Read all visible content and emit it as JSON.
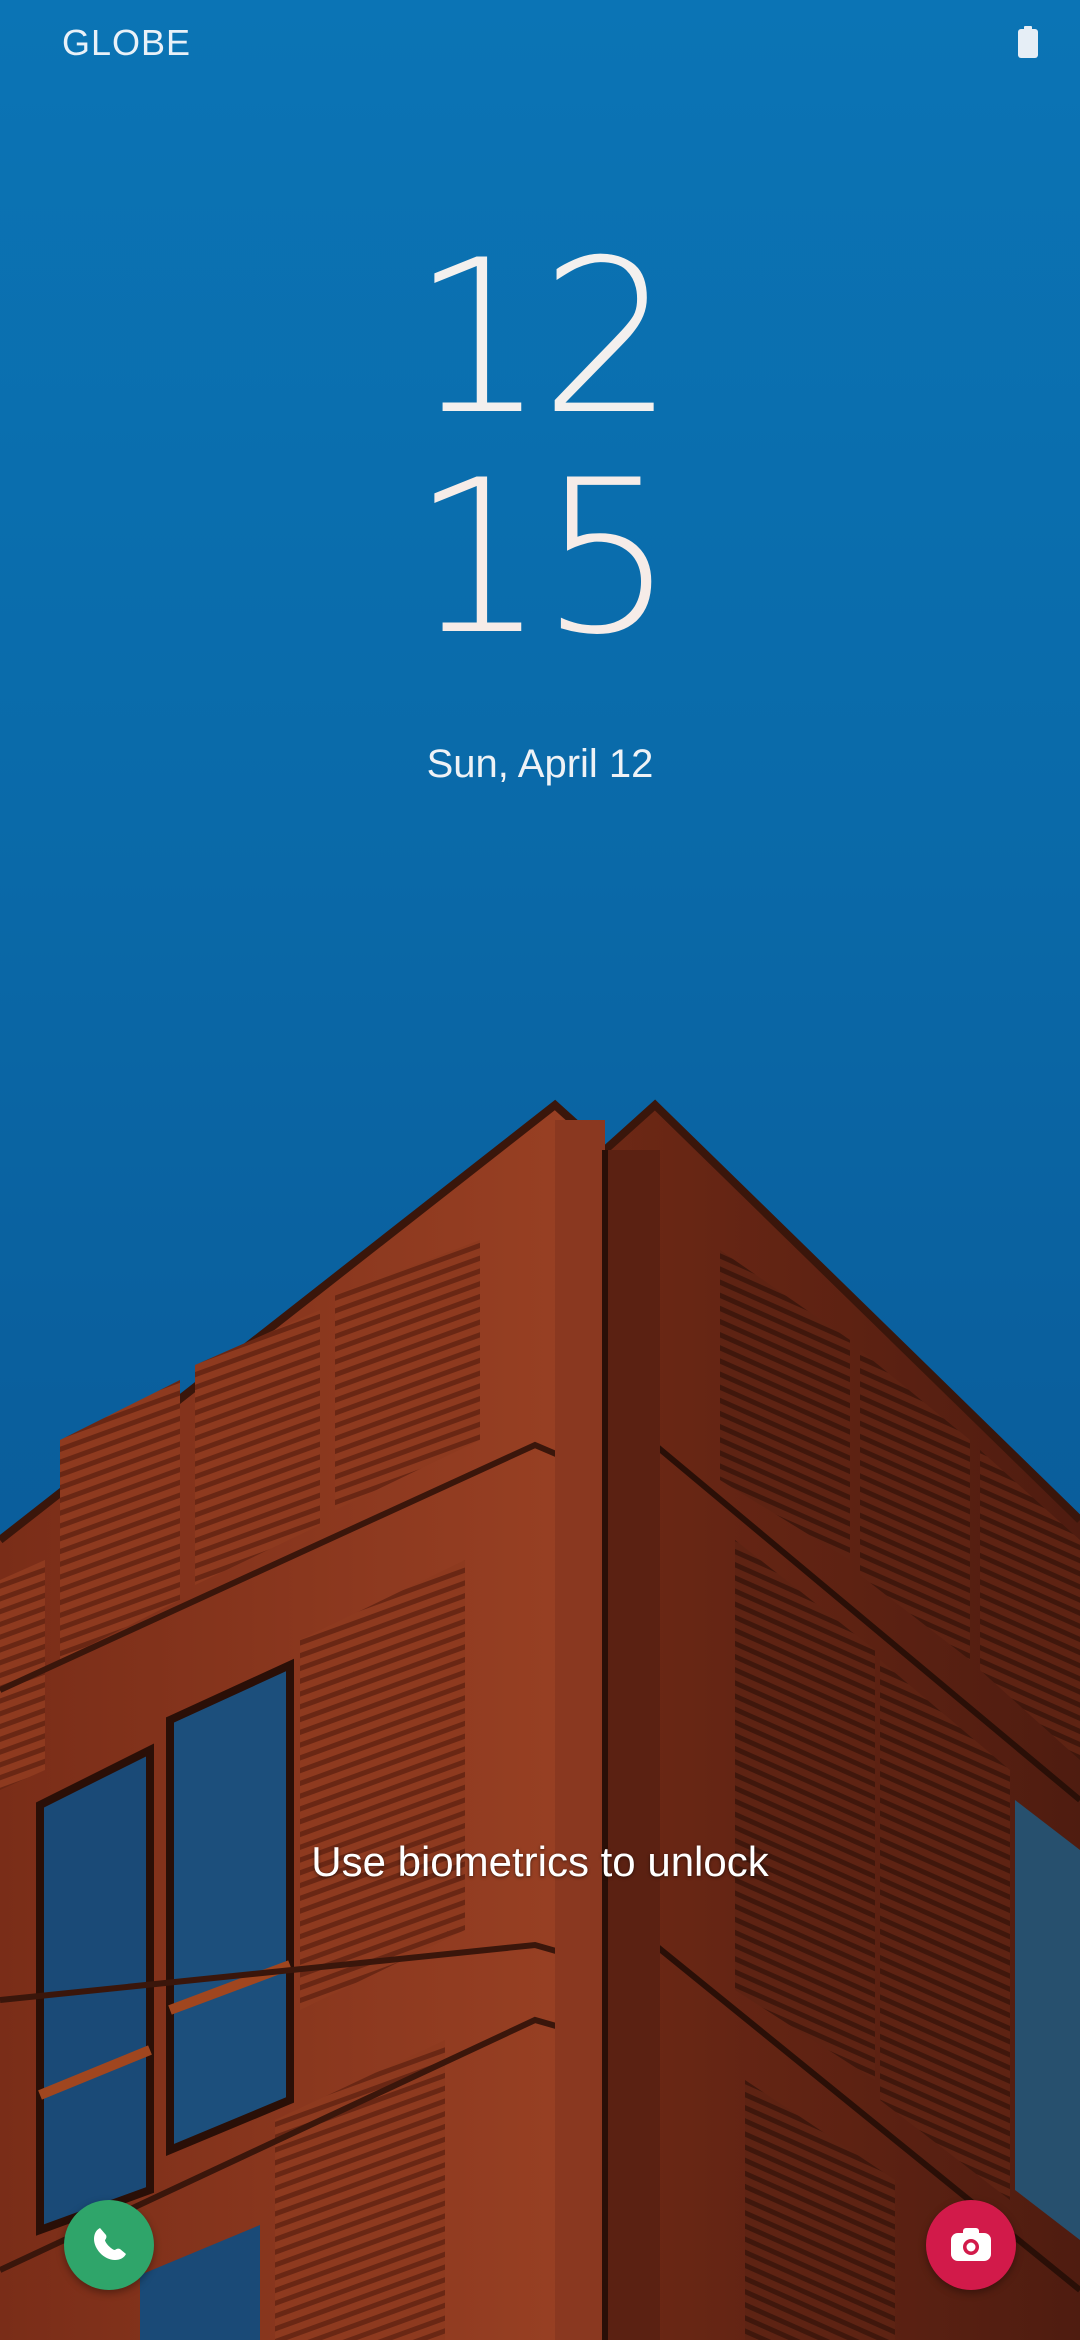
{
  "status_bar": {
    "carrier": "GLOBE",
    "battery_icon": "battery-icon"
  },
  "lockscreen": {
    "clock_hours": "12",
    "clock_minutes": "15",
    "date": "Sun, April 12",
    "unlock_hint": "Use biometrics to unlock"
  },
  "shortcuts": {
    "phone": {
      "icon": "phone-icon",
      "color": "#2fa56a"
    },
    "camera": {
      "icon": "camera-icon",
      "color": "#d21a4a"
    }
  },
  "wallpaper": {
    "sky_color": "#0a66a6",
    "building_color": "#8a3a1e"
  }
}
